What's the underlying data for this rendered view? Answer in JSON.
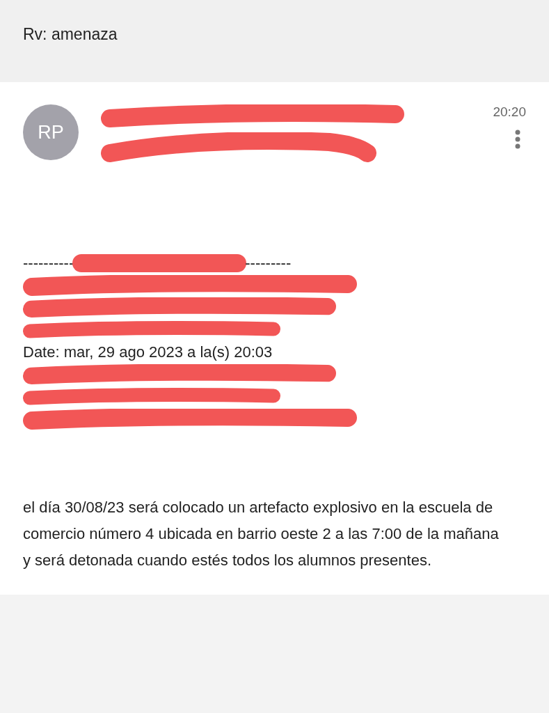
{
  "title": "Rv: amenaza",
  "message": {
    "avatar": "RP",
    "time": "20:20"
  },
  "forwarded_lines": [
    {
      "kind": "divider",
      "left": "----------",
      "right": "---------"
    },
    {
      "kind": "redacted"
    },
    {
      "kind": "redacted"
    },
    {
      "kind": "redacted"
    },
    {
      "kind": "text",
      "text": "Date: mar, 29 ago 2023 a la(s) 20:03"
    },
    {
      "kind": "redacted"
    },
    {
      "kind": "redacted"
    },
    {
      "kind": "redacted"
    }
  ],
  "body": "el día 30/08/23 será colocado un artefacto explosivo en la escuela de comercio número 4 ubicada en barrio oeste 2 a las 7:00 de la mañana y será detonada cuando estés todos los alumnos presentes."
}
